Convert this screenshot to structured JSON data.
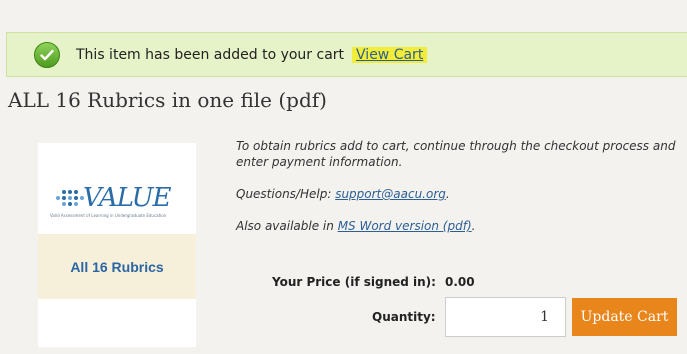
{
  "notice": {
    "message": "This item has been added to your cart",
    "view_cart_label": "View Cart"
  },
  "product": {
    "title": "ALL 16 Rubrics in one file (pdf)",
    "image": {
      "logo_word": "VALUE",
      "logo_tagline": "Valid Assessment of Learning in Undergraduate Education",
      "banner_text": "All 16 Rubrics"
    },
    "description": {
      "line1": "To obtain rubrics add to cart, continue through the checkout process and enter payment information.",
      "help_prefix": "Questions/Help: ",
      "help_email": "support@aacu.org",
      "help_suffix": ".",
      "also_prefix": "Also available in ",
      "also_link": "MS Word version (pdf)",
      "also_suffix": "."
    }
  },
  "pricing": {
    "price_label": "Your Price (if signed in):",
    "price_value": "0.00",
    "quantity_label": "Quantity:",
    "quantity_value": "1",
    "update_label": "Update Cart"
  },
  "colors": {
    "notice_bg": "#e6f2c7",
    "link": "#2d5f95",
    "button": "#e8851b",
    "highlight": "#f2ec3a"
  }
}
